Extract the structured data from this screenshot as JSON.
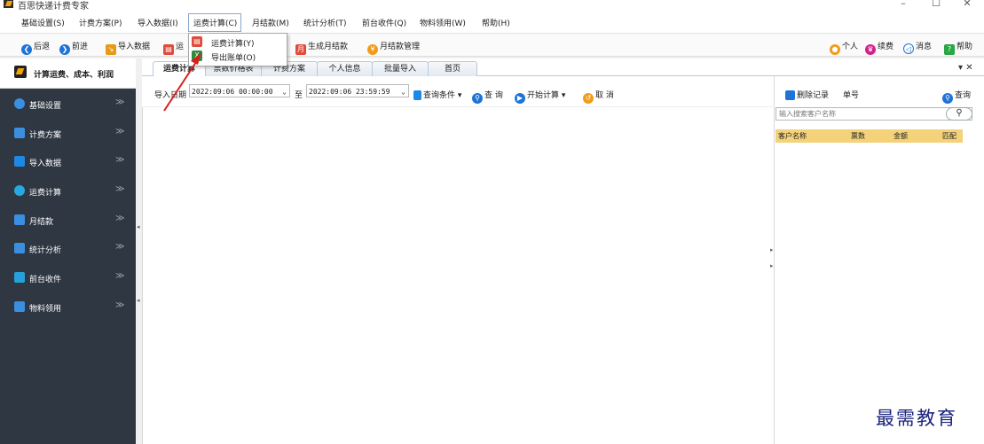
{
  "window": {
    "title": "百思快递计费专家",
    "min": "–",
    "max": "☐",
    "close": "✕"
  },
  "menu": [
    {
      "label": "基础设置(S)"
    },
    {
      "label": "计费方案(P)"
    },
    {
      "label": "导入数据(I)"
    },
    {
      "label": "运费计算(C)"
    },
    {
      "label": "月结款(M)"
    },
    {
      "label": "统计分析(T)"
    },
    {
      "label": "前台收件(Q)"
    },
    {
      "label": "物料领用(W)"
    },
    {
      "label": "帮助(H)"
    }
  ],
  "dropdown": {
    "items": [
      {
        "label": "运费计算(Y)"
      },
      {
        "label": "导出账单(O)"
      }
    ]
  },
  "toolbar": {
    "back": "后退",
    "forward": "前进",
    "import": "导入数据",
    "calc_partial": "运",
    "monthly": "生成月结款",
    "monthly_manage": "月结款管理",
    "personal": "个人",
    "renew": "续费",
    "message": "消息",
    "help": "帮助"
  },
  "sidebar": {
    "title": "计算运费、成本、利润",
    "items": [
      {
        "label": "基础设置",
        "color": "#3b8fe0"
      },
      {
        "label": "计费方案",
        "color": "#3b8fe0"
      },
      {
        "label": "导入数据",
        "color": "#1e88e5"
      },
      {
        "label": "运费计算",
        "color": "#29a7e0"
      },
      {
        "label": "月结款",
        "color": "#3b8fe0"
      },
      {
        "label": "统计分析",
        "color": "#3b8fe0"
      },
      {
        "label": "前台收件",
        "color": "#26a0da"
      },
      {
        "label": "物料领用",
        "color": "#3b8fe0"
      }
    ],
    "chevron": "≫"
  },
  "tabs": [
    {
      "label": "运费计算"
    },
    {
      "label": "票数价格表"
    },
    {
      "label": "计费方案"
    },
    {
      "label": "个人信息"
    },
    {
      "label": "批量导入"
    },
    {
      "label": "首页"
    }
  ],
  "tab_controls": "▾ ✕",
  "query": {
    "date_label": "导入日期",
    "start": "2022:09:06 00:00:00",
    "to": "至",
    "end": "2022:09:06 23:59:59",
    "conditions": "查询条件",
    "query": "查 询",
    "start_calc": "开始计算",
    "cancel": "取 消"
  },
  "right_panel": {
    "delete": "删除记录",
    "order_no": "单号",
    "query": "查询",
    "search_placeholder": "输入搜索客户名称",
    "columns": [
      "客户名称",
      "票数",
      "金额",
      "匹配"
    ]
  },
  "watermark": "最需教育"
}
